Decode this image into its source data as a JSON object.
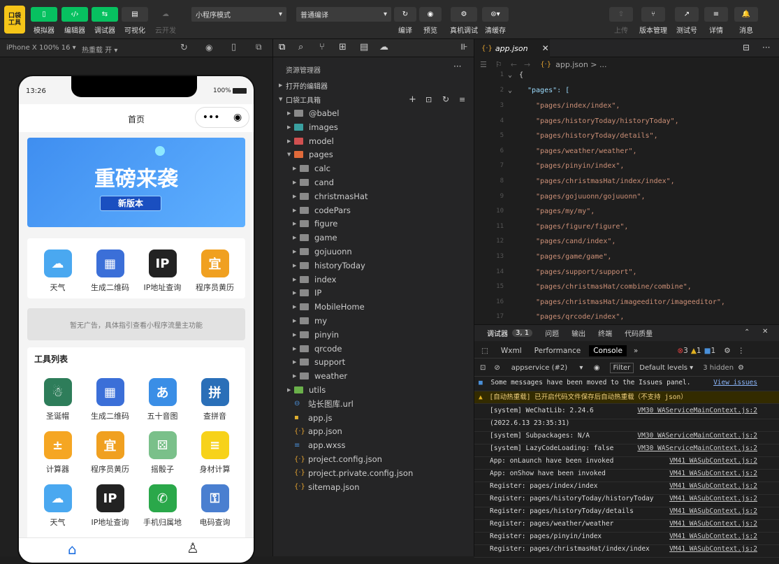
{
  "toolbar": {
    "left_buttons": [
      {
        "label": "模拟器",
        "icon": "phone-icon",
        "color": "#07c160"
      },
      {
        "label": "编辑器",
        "icon": "code-icon",
        "color": "#07c160"
      },
      {
        "label": "调试器",
        "icon": "debug-icon",
        "color": "#07c160"
      },
      {
        "label": "可视化",
        "icon": "layout-icon",
        "color": "#3a3a3a"
      },
      {
        "label": "云开发",
        "icon": "cloud-icon",
        "color": "#2b2b2b"
      }
    ],
    "mode_select": "小程序模式",
    "compile_select": "普通编译",
    "mid_buttons": [
      "编译",
      "预览",
      "真机调试",
      "清缓存"
    ],
    "right_buttons": [
      "上传",
      "版本管理",
      "测试号",
      "详情",
      "消息"
    ]
  },
  "subbar": {
    "device": "iPhone X 100% 16",
    "hot_reload": "热重载 开"
  },
  "phone": {
    "time": "13:26",
    "battery": "100%",
    "title": "首页",
    "banner_main": "重磅来袭",
    "banner_sub": "新版本",
    "top_apps": [
      {
        "label": "天气",
        "icon": "weather-icon",
        "color": "#4aa8f0",
        "glyph": "☁"
      },
      {
        "label": "生成二维码",
        "icon": "qrcode-icon",
        "color": "#3b6fd8",
        "glyph": "▦"
      },
      {
        "label": "IP地址查询",
        "icon": "ip-icon",
        "color": "#222222",
        "glyph": "IP"
      },
      {
        "label": "程序员黄历",
        "icon": "calendar-icon",
        "color": "#f0a020",
        "glyph": "宜"
      }
    ],
    "ad_text": "暂无广告，具体指引查看小程序流量主功能",
    "tools_title": "工具列表",
    "tools": [
      {
        "label": "圣诞帽",
        "icon": "santa-icon",
        "color": "#2e7d5a",
        "glyph": "☃"
      },
      {
        "label": "生成二维码",
        "icon": "qrcode-icon",
        "color": "#3b6fd8",
        "glyph": "▦"
      },
      {
        "label": "五十音图",
        "icon": "kana-icon",
        "color": "#3a8ee6",
        "glyph": "あ"
      },
      {
        "label": "查拼音",
        "icon": "pinyin-icon",
        "color": "#2a6fb8",
        "glyph": "拼"
      },
      {
        "label": "计算器",
        "icon": "calculator-icon",
        "color": "#f5a623",
        "glyph": "±"
      },
      {
        "label": "程序员黄历",
        "icon": "calendar-icon",
        "color": "#f0a020",
        "glyph": "宜"
      },
      {
        "label": "摇骰子",
        "icon": "dice-icon",
        "color": "#7ac08a",
        "glyph": "⚄"
      },
      {
        "label": "身材计算",
        "icon": "body-icon",
        "color": "#f7d21a",
        "glyph": "≡"
      },
      {
        "label": "天气",
        "icon": "weather-icon",
        "color": "#4aa8f0",
        "glyph": "☁"
      },
      {
        "label": "IP地址查询",
        "icon": "ip-icon",
        "color": "#222222",
        "glyph": "IP"
      },
      {
        "label": "手机归属地",
        "icon": "phone-call-icon",
        "color": "#2aa84a",
        "glyph": "✆"
      },
      {
        "label": "电码查询",
        "icon": "shield-icon",
        "color": "#4a7fd0",
        "glyph": "⚿"
      }
    ]
  },
  "explorer": {
    "header": "资源管理器",
    "open_editors": "打开的编辑器",
    "project": "口袋工具箱",
    "tree": [
      {
        "name": "@babel",
        "depth": 1,
        "type": "folder",
        "open": false,
        "color": "#8a8a8a"
      },
      {
        "name": "images",
        "depth": 1,
        "type": "folder",
        "open": false,
        "color": "#3aa0a0"
      },
      {
        "name": "model",
        "depth": 1,
        "type": "folder",
        "open": false,
        "color": "#d05050"
      },
      {
        "name": "pages",
        "depth": 1,
        "type": "folder",
        "open": true,
        "color": "#e06a3a"
      },
      {
        "name": "calc",
        "depth": 2,
        "type": "folder",
        "open": false,
        "color": "#8a8a8a"
      },
      {
        "name": "cand",
        "depth": 2,
        "type": "folder",
        "open": false,
        "color": "#8a8a8a"
      },
      {
        "name": "christmasHat",
        "depth": 2,
        "type": "folder",
        "open": false,
        "color": "#8a8a8a"
      },
      {
        "name": "codePars",
        "depth": 2,
        "type": "folder",
        "open": false,
        "color": "#8a8a8a"
      },
      {
        "name": "figure",
        "depth": 2,
        "type": "folder",
        "open": false,
        "color": "#8a8a8a"
      },
      {
        "name": "game",
        "depth": 2,
        "type": "folder",
        "open": false,
        "color": "#8a8a8a"
      },
      {
        "name": "gojuuonn",
        "depth": 2,
        "type": "folder",
        "open": false,
        "color": "#8a8a8a"
      },
      {
        "name": "historyToday",
        "depth": 2,
        "type": "folder",
        "open": false,
        "color": "#8a8a8a"
      },
      {
        "name": "index",
        "depth": 2,
        "type": "folder",
        "open": false,
        "color": "#8a8a8a"
      },
      {
        "name": "IP",
        "depth": 2,
        "type": "folder",
        "open": false,
        "color": "#8a8a8a"
      },
      {
        "name": "MobileHome",
        "depth": 2,
        "type": "folder",
        "open": false,
        "color": "#8a8a8a"
      },
      {
        "name": "my",
        "depth": 2,
        "type": "folder",
        "open": false,
        "color": "#8a8a8a"
      },
      {
        "name": "pinyin",
        "depth": 2,
        "type": "folder",
        "open": false,
        "color": "#8a8a8a"
      },
      {
        "name": "qrcode",
        "depth": 2,
        "type": "folder",
        "open": false,
        "color": "#8a8a8a"
      },
      {
        "name": "support",
        "depth": 2,
        "type": "folder",
        "open": false,
        "color": "#8a8a8a"
      },
      {
        "name": "weather",
        "depth": 2,
        "type": "folder",
        "open": false,
        "color": "#8a8a8a"
      },
      {
        "name": "utils",
        "depth": 1,
        "type": "folder",
        "open": false,
        "color": "#6ab04a"
      },
      {
        "name": "站长图库.url",
        "depth": 1,
        "type": "file",
        "glyph": "⊖",
        "color": "#4a90d9"
      },
      {
        "name": "app.js",
        "depth": 1,
        "type": "file",
        "glyph": "▪",
        "color": "#e0b030"
      },
      {
        "name": "app.json",
        "depth": 1,
        "type": "file",
        "glyph": "{·}",
        "color": "#e0a030"
      },
      {
        "name": "app.wxss",
        "depth": 1,
        "type": "file",
        "glyph": "≡",
        "color": "#4a90d9"
      },
      {
        "name": "project.config.json",
        "depth": 1,
        "type": "file",
        "glyph": "{·}",
        "color": "#e0a030"
      },
      {
        "name": "project.private.config.json",
        "depth": 1,
        "type": "file",
        "glyph": "{·}",
        "color": "#e0a030"
      },
      {
        "name": "sitemap.json",
        "depth": 1,
        "type": "file",
        "glyph": "{·}",
        "color": "#e0a030"
      }
    ]
  },
  "editor": {
    "tab": "app.json",
    "breadcrumb": "app.json > ...",
    "code_key": "\"pages\": [",
    "pages": [
      "\"pages/index/index\",",
      "\"pages/historyToday/historyToday\",",
      "\"pages/historyToday/details\",",
      "\"pages/weather/weather\",",
      "\"pages/pinyin/index\",",
      "\"pages/christmasHat/index/index\",",
      "\"pages/gojuuonn/gojuuonn\",",
      "\"pages/my/my\",",
      "\"pages/figure/figure\",",
      "\"pages/cand/index\",",
      "\"pages/game/game\",",
      "\"pages/support/support\",",
      "\"pages/christmasHat/combine/combine\",",
      "\"pages/christmasHat/imageeditor/imageeditor\",",
      "\"pages/qrcode/index\","
    ]
  },
  "devtools": {
    "tabs": [
      "调试器",
      "问题",
      "输出",
      "终端",
      "代码质量"
    ],
    "badge": "3, 1",
    "panel_tabs": [
      "Wxml",
      "Performance",
      "Console"
    ],
    "errors": "3",
    "warnings": "1",
    "infos": "1",
    "context": "appservice (#2)",
    "filter": "Filter",
    "levels": "Default levels",
    "hidden": "3 hidden",
    "notice": "Some messages have been moved to the Issues panel.",
    "notice_link": "View issues",
    "warn": "[自动热重载] 已开启代码文件保存后自动热重载（不支持 json）",
    "logs": [
      {
        "text": "[system] WeChatLib: 2.24.6",
        "src": "VM30 WAServiceMainContext.js:2"
      },
      {
        "text": "(2022.6.13 23:35:31)",
        "src": ""
      },
      {
        "text": "[system] Subpackages: N/A",
        "src": "VM30 WAServiceMainContext.js:2"
      },
      {
        "text": "[system] LazyCodeLoading: false",
        "src": "VM30 WAServiceMainContext.js:2"
      },
      {
        "text": "App: onLaunch have been invoked",
        "src": "VM41 WASubContext.js:2"
      },
      {
        "text": "App: onShow have been invoked",
        "src": "VM41 WASubContext.js:2"
      },
      {
        "text": "Register: pages/index/index",
        "src": "VM41 WASubContext.js:2"
      },
      {
        "text": "Register: pages/historyToday/historyToday",
        "src": "VM41 WASubContext.js:2"
      },
      {
        "text": "Register: pages/historyToday/details",
        "src": "VM41 WASubContext.js:2"
      },
      {
        "text": "Register: pages/weather/weather",
        "src": "VM41 WASubContext.js:2"
      },
      {
        "text": "Register: pages/pinyin/index",
        "src": "VM41 WASubContext.js:2"
      },
      {
        "text": "Register: pages/christmasHat/index/index",
        "src": "VM41 WASubContext.js:2"
      }
    ]
  }
}
